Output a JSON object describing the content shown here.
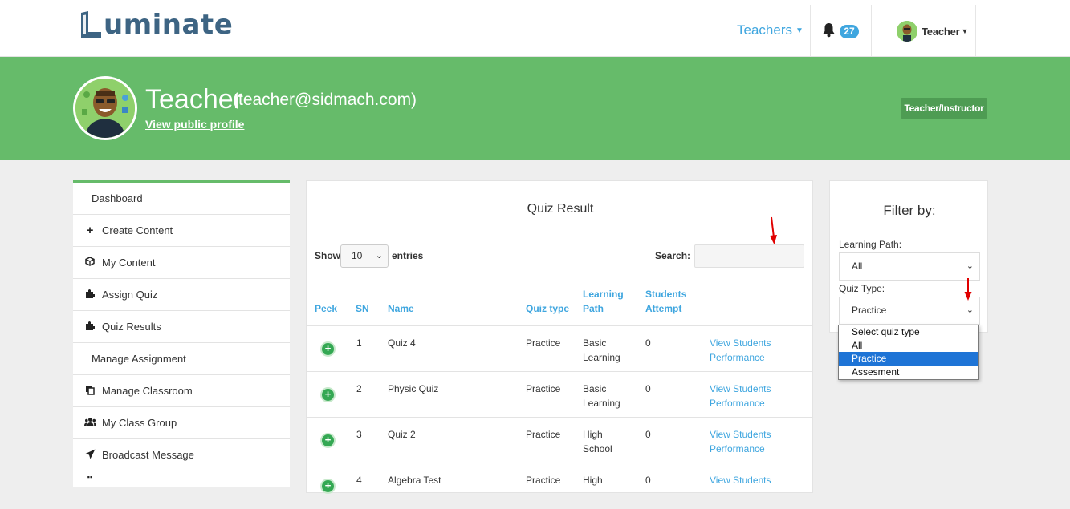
{
  "brand": {
    "logo_text": "uminate",
    "logo_initial": "L"
  },
  "navbar": {
    "teachers_label": "Teachers",
    "notification_count": "27",
    "user_label": "Teacher"
  },
  "profile": {
    "name": "Teacher",
    "email": "(teacher@sidmach.com)",
    "public_profile_link": "View public profile",
    "role_badge": "Teacher/Instructor"
  },
  "sidebar": {
    "items": [
      {
        "label": "Dashboard",
        "icon": "none"
      },
      {
        "label": "Create Content",
        "icon": "plus-icon"
      },
      {
        "label": "My Content",
        "icon": "cube-icon"
      },
      {
        "label": "Assign Quiz",
        "icon": "puzzle-icon"
      },
      {
        "label": "Quiz Results",
        "icon": "puzzle-icon"
      },
      {
        "label": "Manage Assignment",
        "icon": "none"
      },
      {
        "label": "Manage Classroom",
        "icon": "copy-icon"
      },
      {
        "label": "My Class Group",
        "icon": "users-icon"
      },
      {
        "label": "Broadcast Message",
        "icon": "paper-plane-icon"
      }
    ]
  },
  "quiz_result": {
    "title": "Quiz Result",
    "show_label": "Show",
    "entries_value": "10",
    "entries_label": "entries",
    "search_label": "Search:",
    "search_value": "",
    "columns": [
      "Peek",
      "SN",
      "Name",
      "Quiz type",
      "Learning Path",
      "Students Attempt"
    ],
    "column_lines": {
      "learning_path": [
        "Learning",
        "Path"
      ],
      "students_attempt": [
        "Students",
        "Attempt"
      ]
    },
    "rows": [
      {
        "sn": "1",
        "name": "Quiz 4",
        "type": "Practice",
        "path": [
          "Basic",
          "Learning"
        ],
        "attempt": "0",
        "action": [
          "View Students",
          "Performance"
        ]
      },
      {
        "sn": "2",
        "name": "Physic Quiz",
        "type": "Practice",
        "path": [
          "Basic",
          "Learning"
        ],
        "attempt": "0",
        "action": [
          "View Students",
          "Performance"
        ]
      },
      {
        "sn": "3",
        "name": "Quiz 2",
        "type": "Practice",
        "path": [
          "High",
          "School"
        ],
        "attempt": "0",
        "action": [
          "View Students",
          "Performance"
        ]
      },
      {
        "sn": "4",
        "name": "Algebra Test",
        "type": "Practice",
        "path": [
          "High",
          ""
        ],
        "attempt": "0",
        "action": [
          "View Students",
          ""
        ]
      }
    ]
  },
  "filter": {
    "title": "Filter by:",
    "learning_path_label": "Learning Path:",
    "learning_path_value": "All",
    "quiz_type_label": "Quiz Type:",
    "quiz_type_value": "Practice",
    "quiz_type_options": [
      "Select quiz type",
      "All",
      "Practice",
      "Assesment"
    ],
    "quiz_type_selected_index": 2
  },
  "colors": {
    "brand_green": "#66bb6a",
    "link_blue": "#3fa6df",
    "logo_navy": "#3d6483",
    "selected_option": "#1e74d6",
    "annotation_arrow": "#e00000"
  }
}
